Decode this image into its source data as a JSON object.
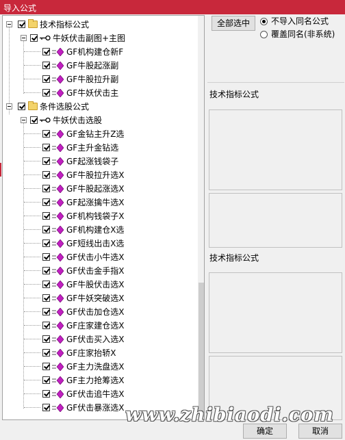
{
  "window": {
    "title": "导入公式"
  },
  "tree": {
    "groups": [
      {
        "label": "技术指标公式",
        "sub": {
          "label": "牛妖伏击副图+主图",
          "items": [
            "GF机构建仓新F",
            "GF牛股起涨副",
            "GF牛股拉升副",
            "GF牛妖伏击主"
          ]
        }
      },
      {
        "label": "条件选股公式",
        "sub": {
          "label": "牛妖伏击选股",
          "items": [
            "GF金钻主升Z选",
            "GF主升金钻选",
            "GF起涨钱袋子",
            "GF牛股拉升选X",
            "GF牛股起涨选X",
            "GF起涨擒牛选X",
            "GF机构钱袋子X",
            "GF机构建仓X选",
            "GF短线出击X选",
            "GF伏击小牛选X",
            "GF伏击金手指X",
            "GF牛股伏击选X",
            "GF牛妖突破选X",
            "GF伏击加仓选X",
            "GF庄家建仓选X",
            "GF伏击买入选X",
            "GF庄家抬轿X",
            "GF主力洗盘选X",
            "GF主力抢筹选X",
            "GF伏击追牛选X",
            "GF伏击暴涨选X"
          ]
        }
      }
    ]
  },
  "right": {
    "select_all": "全部选中",
    "radio1": "不导入同名公式",
    "radio2": "覆盖同名(非系统)",
    "section1": "技术指标公式",
    "section2": "技术指标公式"
  },
  "buttons": {
    "ok": "确定",
    "cancel": "取消"
  },
  "watermark": "www.zhibiaodi.com",
  "colors": {
    "titlebar": "#c8283b",
    "item_icon": "#c020c0"
  }
}
